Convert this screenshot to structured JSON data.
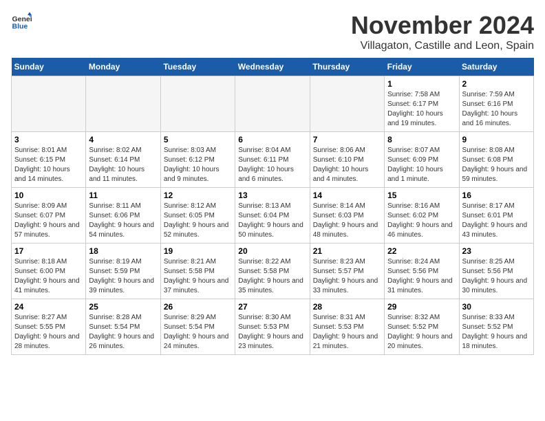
{
  "header": {
    "logo_text_general": "General",
    "logo_text_blue": "Blue",
    "month": "November 2024",
    "location": "Villagaton, Castille and Leon, Spain"
  },
  "calendar": {
    "days_of_week": [
      "Sunday",
      "Monday",
      "Tuesday",
      "Wednesday",
      "Thursday",
      "Friday",
      "Saturday"
    ],
    "weeks": [
      [
        {
          "day": "",
          "detail": "",
          "empty": true
        },
        {
          "day": "",
          "detail": "",
          "empty": true
        },
        {
          "day": "",
          "detail": "",
          "empty": true
        },
        {
          "day": "",
          "detail": "",
          "empty": true
        },
        {
          "day": "",
          "detail": "",
          "empty": true
        },
        {
          "day": "1",
          "detail": "Sunrise: 7:58 AM\nSunset: 6:17 PM\nDaylight: 10 hours and 19 minutes.",
          "empty": false
        },
        {
          "day": "2",
          "detail": "Sunrise: 7:59 AM\nSunset: 6:16 PM\nDaylight: 10 hours and 16 minutes.",
          "empty": false
        }
      ],
      [
        {
          "day": "3",
          "detail": "Sunrise: 8:01 AM\nSunset: 6:15 PM\nDaylight: 10 hours and 14 minutes.",
          "empty": false
        },
        {
          "day": "4",
          "detail": "Sunrise: 8:02 AM\nSunset: 6:14 PM\nDaylight: 10 hours and 11 minutes.",
          "empty": false
        },
        {
          "day": "5",
          "detail": "Sunrise: 8:03 AM\nSunset: 6:12 PM\nDaylight: 10 hours and 9 minutes.",
          "empty": false
        },
        {
          "day": "6",
          "detail": "Sunrise: 8:04 AM\nSunset: 6:11 PM\nDaylight: 10 hours and 6 minutes.",
          "empty": false
        },
        {
          "day": "7",
          "detail": "Sunrise: 8:06 AM\nSunset: 6:10 PM\nDaylight: 10 hours and 4 minutes.",
          "empty": false
        },
        {
          "day": "8",
          "detail": "Sunrise: 8:07 AM\nSunset: 6:09 PM\nDaylight: 10 hours and 1 minute.",
          "empty": false
        },
        {
          "day": "9",
          "detail": "Sunrise: 8:08 AM\nSunset: 6:08 PM\nDaylight: 9 hours and 59 minutes.",
          "empty": false
        }
      ],
      [
        {
          "day": "10",
          "detail": "Sunrise: 8:09 AM\nSunset: 6:07 PM\nDaylight: 9 hours and 57 minutes.",
          "empty": false
        },
        {
          "day": "11",
          "detail": "Sunrise: 8:11 AM\nSunset: 6:06 PM\nDaylight: 9 hours and 54 minutes.",
          "empty": false
        },
        {
          "day": "12",
          "detail": "Sunrise: 8:12 AM\nSunset: 6:05 PM\nDaylight: 9 hours and 52 minutes.",
          "empty": false
        },
        {
          "day": "13",
          "detail": "Sunrise: 8:13 AM\nSunset: 6:04 PM\nDaylight: 9 hours and 50 minutes.",
          "empty": false
        },
        {
          "day": "14",
          "detail": "Sunrise: 8:14 AM\nSunset: 6:03 PM\nDaylight: 9 hours and 48 minutes.",
          "empty": false
        },
        {
          "day": "15",
          "detail": "Sunrise: 8:16 AM\nSunset: 6:02 PM\nDaylight: 9 hours and 46 minutes.",
          "empty": false
        },
        {
          "day": "16",
          "detail": "Sunrise: 8:17 AM\nSunset: 6:01 PM\nDaylight: 9 hours and 43 minutes.",
          "empty": false
        }
      ],
      [
        {
          "day": "17",
          "detail": "Sunrise: 8:18 AM\nSunset: 6:00 PM\nDaylight: 9 hours and 41 minutes.",
          "empty": false
        },
        {
          "day": "18",
          "detail": "Sunrise: 8:19 AM\nSunset: 5:59 PM\nDaylight: 9 hours and 39 minutes.",
          "empty": false
        },
        {
          "day": "19",
          "detail": "Sunrise: 8:21 AM\nSunset: 5:58 PM\nDaylight: 9 hours and 37 minutes.",
          "empty": false
        },
        {
          "day": "20",
          "detail": "Sunrise: 8:22 AM\nSunset: 5:58 PM\nDaylight: 9 hours and 35 minutes.",
          "empty": false
        },
        {
          "day": "21",
          "detail": "Sunrise: 8:23 AM\nSunset: 5:57 PM\nDaylight: 9 hours and 33 minutes.",
          "empty": false
        },
        {
          "day": "22",
          "detail": "Sunrise: 8:24 AM\nSunset: 5:56 PM\nDaylight: 9 hours and 31 minutes.",
          "empty": false
        },
        {
          "day": "23",
          "detail": "Sunrise: 8:25 AM\nSunset: 5:56 PM\nDaylight: 9 hours and 30 minutes.",
          "empty": false
        }
      ],
      [
        {
          "day": "24",
          "detail": "Sunrise: 8:27 AM\nSunset: 5:55 PM\nDaylight: 9 hours and 28 minutes.",
          "empty": false
        },
        {
          "day": "25",
          "detail": "Sunrise: 8:28 AM\nSunset: 5:54 PM\nDaylight: 9 hours and 26 minutes.",
          "empty": false
        },
        {
          "day": "26",
          "detail": "Sunrise: 8:29 AM\nSunset: 5:54 PM\nDaylight: 9 hours and 24 minutes.",
          "empty": false
        },
        {
          "day": "27",
          "detail": "Sunrise: 8:30 AM\nSunset: 5:53 PM\nDaylight: 9 hours and 23 minutes.",
          "empty": false
        },
        {
          "day": "28",
          "detail": "Sunrise: 8:31 AM\nSunset: 5:53 PM\nDaylight: 9 hours and 21 minutes.",
          "empty": false
        },
        {
          "day": "29",
          "detail": "Sunrise: 8:32 AM\nSunset: 5:52 PM\nDaylight: 9 hours and 20 minutes.",
          "empty": false
        },
        {
          "day": "30",
          "detail": "Sunrise: 8:33 AM\nSunset: 5:52 PM\nDaylight: 9 hours and 18 minutes.",
          "empty": false
        }
      ]
    ]
  }
}
